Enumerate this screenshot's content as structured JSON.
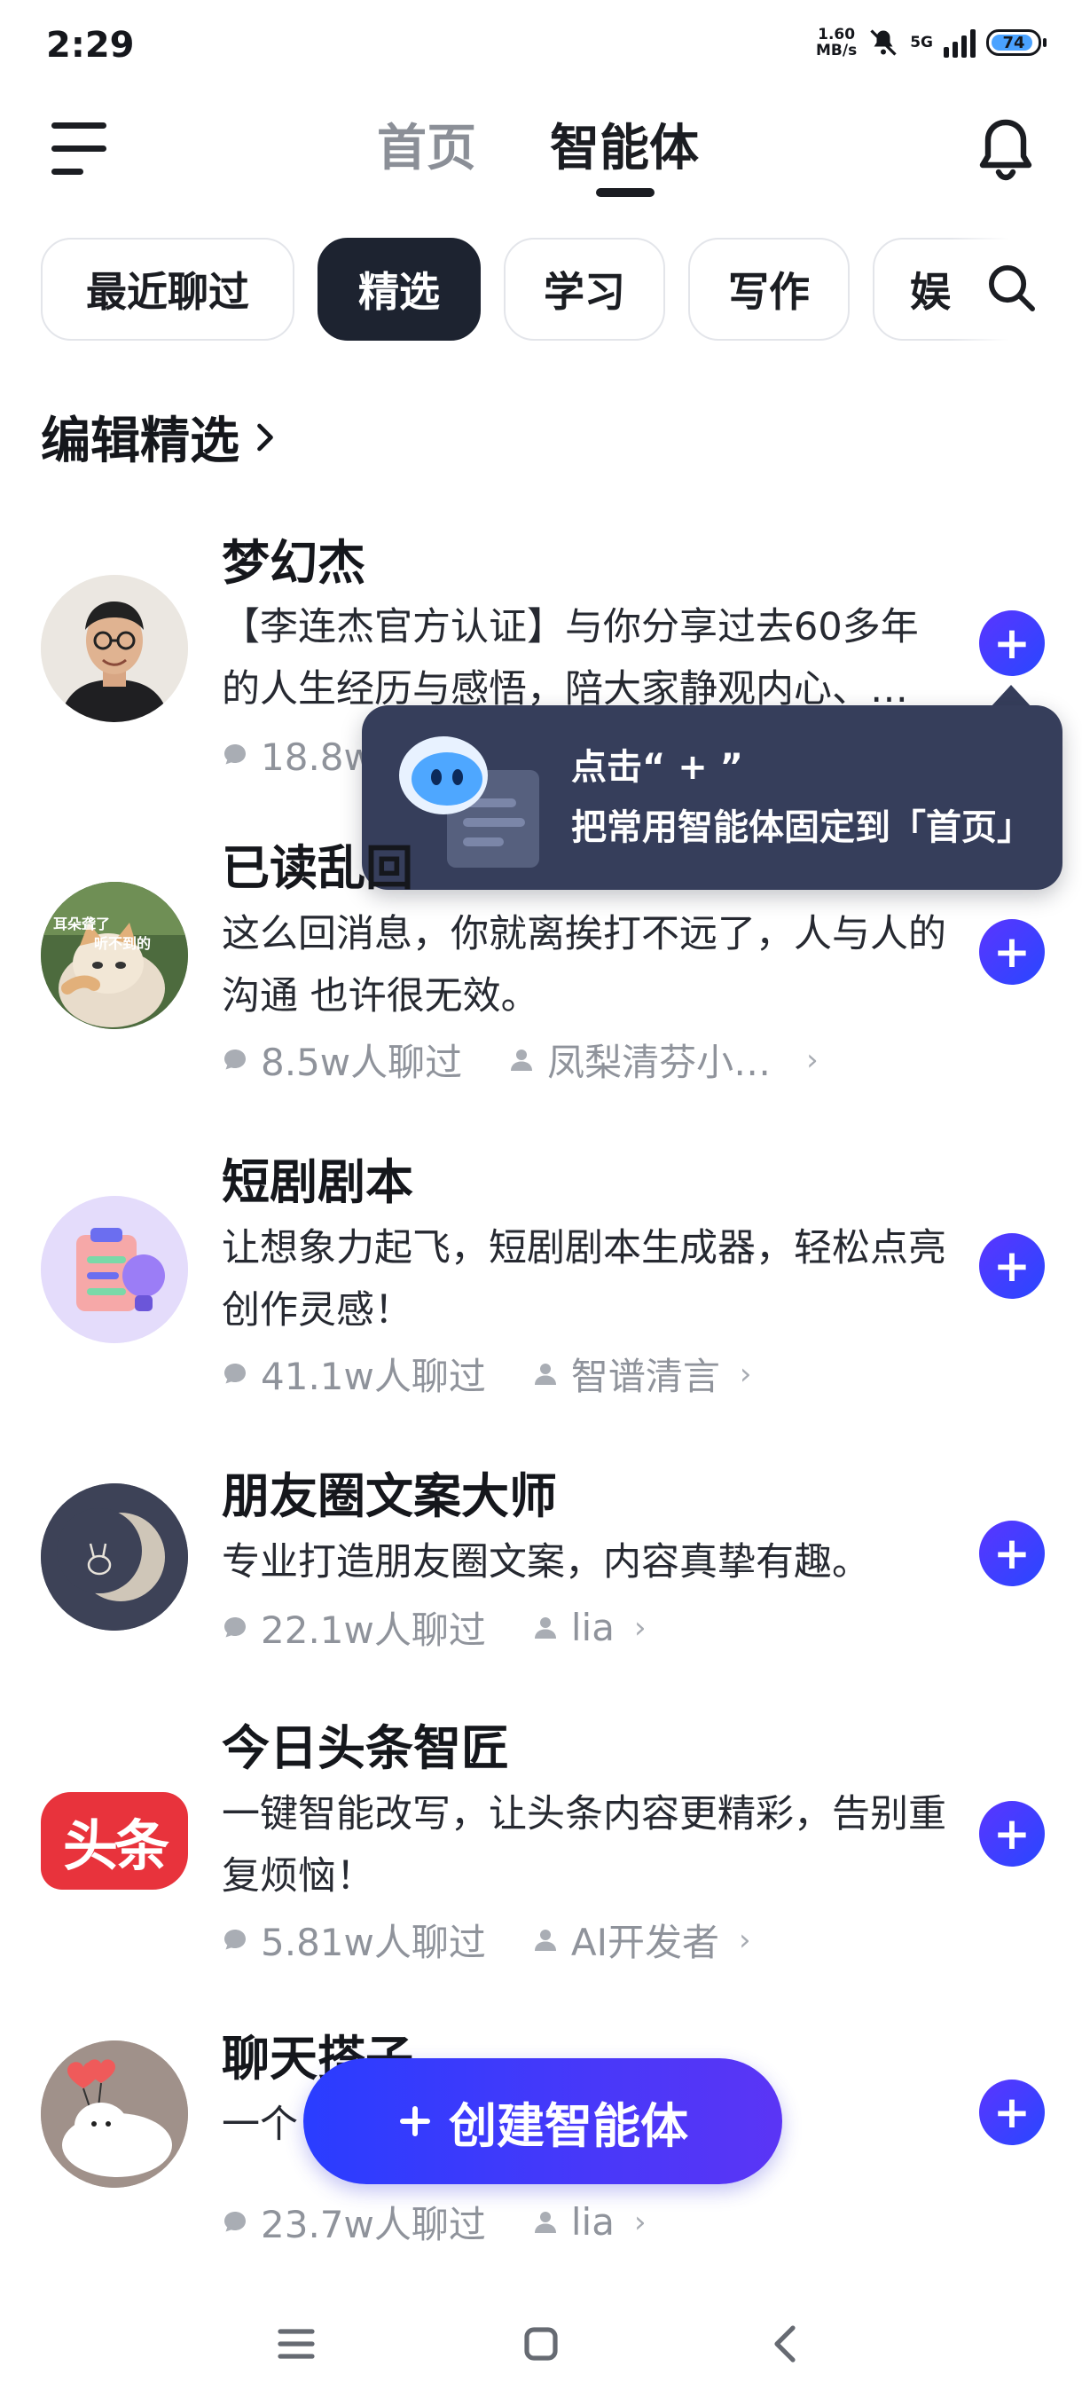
{
  "status_bar": {
    "time": "2:29",
    "net_speed_value": "1.60",
    "net_speed_unit": "MB/s",
    "network": "5G",
    "battery": "74"
  },
  "header": {
    "tabs": [
      {
        "label": "首页",
        "active": false
      },
      {
        "label": "智能体",
        "active": true
      }
    ]
  },
  "categories": [
    {
      "label": "最近聊过",
      "active": false
    },
    {
      "label": "精选",
      "active": true
    },
    {
      "label": "学习",
      "active": false
    },
    {
      "label": "写作",
      "active": false
    },
    {
      "label": "娱",
      "active": false
    }
  ],
  "section": {
    "title": "编辑精选"
  },
  "tooltip": {
    "line1": "点击“ + ”",
    "line2": "把常用智能体固定到「首页」"
  },
  "agents": [
    {
      "title": "梦幻杰",
      "desc": "【李连杰官方认证】与你分享过去60多年的人生经历与感悟，陪大家静观内心、…",
      "chats": "18.8w人聊过",
      "author": ""
    },
    {
      "title": "已读乱回",
      "desc": "这么回消息，你就离挨打不远了，人与人的沟通 也许很无效。",
      "chats": "8.5w人聊过",
      "author": "凤梨清芬小…"
    },
    {
      "title": "短剧剧本",
      "desc": "让想象力起飞，短剧剧本生成器，轻松点亮创作灵感！",
      "chats": "41.1w人聊过",
      "author": "智谱清言"
    },
    {
      "title": "朋友圈文案大师",
      "desc": "专业打造朋友圈文案，内容真挚有趣。",
      "chats": "22.1w人聊过",
      "author": "lia"
    },
    {
      "title": "今日头条智匠",
      "desc": "一键智能改写，让头条内容更精彩，告别重复烦恼！",
      "chats": "5.81w人聊过",
      "author": "AI开发者"
    },
    {
      "title": "聊天搭子",
      "desc": "一个",
      "chats": "23.7w人聊过",
      "author": "lia"
    }
  ],
  "avatar_labels": {
    "cat_top": "耳朵聋了",
    "cat_bottom": "听不到的",
    "toutiao": "头条"
  },
  "create_button": {
    "label": "创建智能体",
    "icon": "plus-icon"
  },
  "colors": {
    "accent": "#3a3dff",
    "chip_active": "#1d2330",
    "tooltip_bg": "#363e5b"
  }
}
